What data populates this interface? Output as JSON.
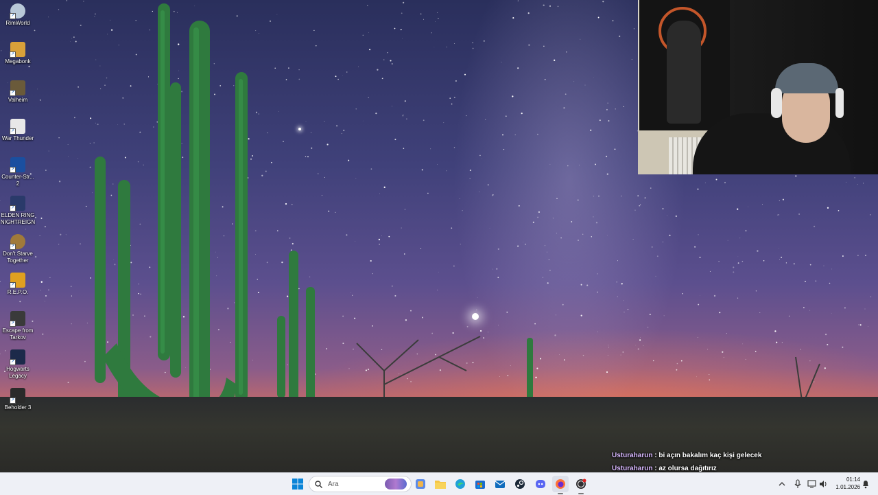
{
  "desktop": {
    "icons": [
      {
        "name": "rimworld",
        "label": "RimWorld",
        "color": "#b8c8d8"
      },
      {
        "name": "megabonk",
        "label": "Megabonk",
        "color": "#d8a03a"
      },
      {
        "name": "valheim",
        "label": "Valheim",
        "color": "#6a5a3a"
      },
      {
        "name": "war-thunder",
        "label": "War Thunder",
        "color": "#e8e8e8"
      },
      {
        "name": "counter-strike-2",
        "label": "Counter-Str... 2",
        "color": "#1a4fa0"
      },
      {
        "name": "elden-ring-nightreign",
        "label": "ELDEN RING NIGHTREIGN",
        "color": "#2a3a6a"
      },
      {
        "name": "dont-starve-together",
        "label": "Don't Starve Together",
        "color": "#a07a3a"
      },
      {
        "name": "repo",
        "label": "R.E.P.O.",
        "color": "#e0a020"
      },
      {
        "name": "escape-from-tarkov",
        "label": "Escape from Tarkov",
        "color": "#3a3a3a"
      },
      {
        "name": "hogwarts-legacy",
        "label": "Hogwarts Legacy",
        "color": "#1c2a4a"
      },
      {
        "name": "beholder-3",
        "label": "Beholder 3",
        "color": "#2a2a2a"
      }
    ]
  },
  "chat": {
    "messages": [
      {
        "user": "Usturaharun",
        "text": "bi açın bakalım kaç kişi gelecek"
      },
      {
        "user": "Usturaharun",
        "text": "az olursa dağıtırız"
      }
    ]
  },
  "taskbar": {
    "search_placeholder": "Ara",
    "apps": [
      "windows-start",
      "task-view",
      "widgets",
      "file-explorer",
      "edge",
      "microsoft-store",
      "outlook",
      "steam",
      "discord",
      "firefox",
      "obs"
    ],
    "clock": {
      "time": "01:14",
      "date": "1.01.2026"
    }
  },
  "colors": {
    "taskbar_bg": "#eef0f6",
    "chat_username": "#d8b8ff",
    "accent": "#0067c0"
  }
}
